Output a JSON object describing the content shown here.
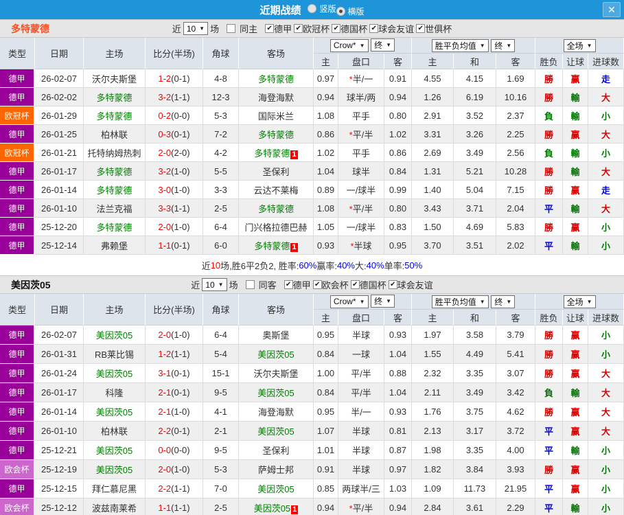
{
  "titlebar": {
    "title": "近期战绩",
    "bar_color": "#1e95d8",
    "radios": [
      {
        "label": "竖版",
        "checked": false
      },
      {
        "label": "横版",
        "checked": true
      }
    ],
    "close_label": "✕"
  },
  "table_head": {
    "static_cols": [
      "类型",
      "日期",
      "主场",
      "比分(半场)",
      "角球",
      "客场"
    ],
    "odds_company_dropdown": "Crow*",
    "odds_final_dropdown": "终",
    "mean_dropdown": "胜平负均值",
    "mean_final_dropdown": "终",
    "scope_dropdown": "全场",
    "sub_cols": [
      "主",
      "盘口",
      "客",
      "主",
      "和",
      "客",
      "胜负",
      "让球",
      "进球数"
    ]
  },
  "league_colors": {
    "德甲": "#990099",
    "欧冠杯": "#ff6600",
    "欧会杯": "#cc66cc"
  },
  "result_colors": {
    "勝": "#dd0000",
    "赢": "#dd0000",
    "大": "#dd0000",
    "負": "#007700",
    "輸": "#007700",
    "小": "#007700",
    "平": "#0000dd",
    "走": "#0000dd"
  },
  "sections": [
    {
      "team": "多特蒙德",
      "team_color": "#ff4f1f",
      "focus": "多特蒙德",
      "filter": {
        "prefix": "近",
        "count": "10",
        "suffix": "场",
        "checkboxes": [
          {
            "label": "同主",
            "checked": false
          },
          {
            "label": "德甲",
            "checked": true
          },
          {
            "label": "欧冠杯",
            "checked": true
          },
          {
            "label": "德国杯",
            "checked": true
          },
          {
            "label": "球会友谊",
            "checked": true
          },
          {
            "label": "世俱杯",
            "checked": true
          }
        ]
      },
      "rows": [
        {
          "league": "德甲",
          "date": "26-02-07",
          "home": "沃尔夫斯堡",
          "home_mark": "",
          "score": "1-2",
          "half": "(0-1)",
          "corner": "4-8",
          "away": "多特蒙德",
          "away_mark": "",
          "odds": [
            "0.97",
            "*半/一",
            "0.91"
          ],
          "means": [
            "4.55",
            "4.15",
            "1.69"
          ],
          "results": [
            "勝",
            "赢",
            "走"
          ]
        },
        {
          "league": "德甲",
          "date": "26-02-02",
          "home": "多特蒙德",
          "home_mark": "",
          "score": "3-2",
          "half": "(1-1)",
          "corner": "12-3",
          "away": "海登海默",
          "away_mark": "",
          "odds": [
            "0.94",
            "球半/两",
            "0.94"
          ],
          "means": [
            "1.26",
            "6.19",
            "10.16"
          ],
          "results": [
            "勝",
            "輸",
            "大"
          ]
        },
        {
          "league": "欧冠杯",
          "date": "26-01-29",
          "home": "多特蒙德",
          "home_mark": "",
          "score": "0-2",
          "half": "(0-0)",
          "corner": "5-3",
          "away": "国际米兰",
          "away_mark": "",
          "odds": [
            "1.08",
            "平手",
            "0.80"
          ],
          "means": [
            "2.91",
            "3.52",
            "2.37"
          ],
          "results": [
            "負",
            "輸",
            "小"
          ]
        },
        {
          "league": "德甲",
          "date": "26-01-25",
          "home": "柏林联",
          "home_mark": "",
          "score": "0-3",
          "half": "(0-1)",
          "corner": "7-2",
          "away": "多特蒙德",
          "away_mark": "",
          "odds": [
            "0.86",
            "*平/半",
            "1.02"
          ],
          "means": [
            "3.31",
            "3.26",
            "2.25"
          ],
          "results": [
            "勝",
            "赢",
            "大"
          ]
        },
        {
          "league": "欧冠杯",
          "date": "26-01-21",
          "home": "托特纳姆热刺",
          "home_mark": "",
          "score": "2-0",
          "half": "(2-0)",
          "corner": "4-2",
          "away": "多特蒙德",
          "away_mark": "1",
          "odds": [
            "1.02",
            "平手",
            "0.86"
          ],
          "means": [
            "2.69",
            "3.49",
            "2.56"
          ],
          "results": [
            "負",
            "輸",
            "小"
          ]
        },
        {
          "league": "德甲",
          "date": "26-01-17",
          "home": "多特蒙德",
          "home_mark": "",
          "score": "3-2",
          "half": "(1-0)",
          "corner": "5-5",
          "away": "圣保利",
          "away_mark": "",
          "odds": [
            "1.04",
            "球半",
            "0.84"
          ],
          "means": [
            "1.31",
            "5.21",
            "10.28"
          ],
          "results": [
            "勝",
            "輸",
            "大"
          ]
        },
        {
          "league": "德甲",
          "date": "26-01-14",
          "home": "多特蒙德",
          "home_mark": "",
          "score": "3-0",
          "half": "(1-0)",
          "corner": "3-3",
          "away": "云达不莱梅",
          "away_mark": "",
          "odds": [
            "0.89",
            "一/球半",
            "0.99"
          ],
          "means": [
            "1.40",
            "5.04",
            "7.15"
          ],
          "results": [
            "勝",
            "赢",
            "走"
          ]
        },
        {
          "league": "德甲",
          "date": "26-01-10",
          "home": "法兰克福",
          "home_mark": "",
          "score": "3-3",
          "half": "(1-1)",
          "corner": "2-5",
          "away": "多特蒙德",
          "away_mark": "",
          "odds": [
            "1.08",
            "*平/半",
            "0.80"
          ],
          "means": [
            "3.43",
            "3.71",
            "2.04"
          ],
          "results": [
            "平",
            "輸",
            "大"
          ]
        },
        {
          "league": "德甲",
          "date": "25-12-20",
          "home": "多特蒙德",
          "home_mark": "",
          "score": "2-0",
          "half": "(1-0)",
          "corner": "6-4",
          "away": "门兴格拉德巴赫",
          "away_mark": "",
          "odds": [
            "1.05",
            "一/球半",
            "0.83"
          ],
          "means": [
            "1.50",
            "4.69",
            "5.83"
          ],
          "results": [
            "勝",
            "赢",
            "小"
          ]
        },
        {
          "league": "德甲",
          "date": "25-12-14",
          "home": "弗赖堡",
          "home_mark": "",
          "score": "1-1",
          "half": "(0-1)",
          "corner": "6-0",
          "away": "多特蒙德",
          "away_mark": "1",
          "odds": [
            "0.93",
            "*半球",
            "0.95"
          ],
          "means": [
            "3.70",
            "3.51",
            "2.02"
          ],
          "results": [
            "平",
            "輸",
            "小"
          ]
        }
      ],
      "summary": [
        [
          "近",
          "#333333"
        ],
        [
          "10",
          "#ff0000"
        ],
        [
          "场,胜6平2负2, 胜率:",
          "#333333"
        ],
        [
          "60%",
          "#0000ee"
        ],
        [
          " 赢率:",
          "#333333"
        ],
        [
          "40%",
          "#0000ee"
        ],
        [
          " 大:",
          "#333333"
        ],
        [
          "40%",
          "#0000ee"
        ],
        [
          " 单率:",
          "#333333"
        ],
        [
          "50%",
          "#0000ee"
        ]
      ]
    },
    {
      "team": "美因茨05",
      "team_color": "#111111",
      "focus": "美因茨05",
      "filter": {
        "prefix": "近",
        "count": "10",
        "suffix": "场",
        "checkboxes": [
          {
            "label": "同客",
            "checked": false
          },
          {
            "label": "德甲",
            "checked": true
          },
          {
            "label": "欧会杯",
            "checked": true
          },
          {
            "label": "德国杯",
            "checked": true
          },
          {
            "label": "球会友谊",
            "checked": true
          }
        ]
      },
      "rows": [
        {
          "league": "德甲",
          "date": "26-02-07",
          "home": "美因茨05",
          "home_mark": "",
          "score": "2-0",
          "half": "(1-0)",
          "corner": "6-4",
          "away": "奥斯堡",
          "away_mark": "",
          "odds": [
            "0.95",
            "半球",
            "0.93"
          ],
          "means": [
            "1.97",
            "3.58",
            "3.79"
          ],
          "results": [
            "勝",
            "赢",
            "小"
          ]
        },
        {
          "league": "德甲",
          "date": "26-01-31",
          "home": "RB莱比锡",
          "home_mark": "",
          "score": "1-2",
          "half": "(1-1)",
          "corner": "5-4",
          "away": "美因茨05",
          "away_mark": "",
          "odds": [
            "0.84",
            "一球",
            "1.04"
          ],
          "means": [
            "1.55",
            "4.49",
            "5.41"
          ],
          "results": [
            "勝",
            "赢",
            "小"
          ]
        },
        {
          "league": "德甲",
          "date": "26-01-24",
          "home": "美因茨05",
          "home_mark": "",
          "score": "3-1",
          "half": "(0-1)",
          "corner": "15-1",
          "away": "沃尔夫斯堡",
          "away_mark": "",
          "odds": [
            "1.00",
            "平/半",
            "0.88"
          ],
          "means": [
            "2.32",
            "3.35",
            "3.07"
          ],
          "results": [
            "勝",
            "赢",
            "大"
          ]
        },
        {
          "league": "德甲",
          "date": "26-01-17",
          "home": "科隆",
          "home_mark": "",
          "score": "2-1",
          "half": "(0-1)",
          "corner": "9-5",
          "away": "美因茨05",
          "away_mark": "",
          "odds": [
            "0.84",
            "平/半",
            "1.04"
          ],
          "means": [
            "2.11",
            "3.49",
            "3.42"
          ],
          "results": [
            "負",
            "輸",
            "大"
          ]
        },
        {
          "league": "德甲",
          "date": "26-01-14",
          "home": "美因茨05",
          "home_mark": "",
          "score": "2-1",
          "half": "(1-0)",
          "corner": "4-1",
          "away": "海登海默",
          "away_mark": "",
          "odds": [
            "0.95",
            "半/一",
            "0.93"
          ],
          "means": [
            "1.76",
            "3.75",
            "4.62"
          ],
          "results": [
            "勝",
            "赢",
            "大"
          ]
        },
        {
          "league": "德甲",
          "date": "26-01-10",
          "home": "柏林联",
          "home_mark": "",
          "score": "2-2",
          "half": "(0-1)",
          "corner": "2-1",
          "away": "美因茨05",
          "away_mark": "",
          "odds": [
            "1.07",
            "半球",
            "0.81"
          ],
          "means": [
            "2.13",
            "3.17",
            "3.72"
          ],
          "results": [
            "平",
            "赢",
            "大"
          ]
        },
        {
          "league": "德甲",
          "date": "25-12-21",
          "home": "美因茨05",
          "home_mark": "",
          "score": "0-0",
          "half": "(0-0)",
          "corner": "9-5",
          "away": "圣保利",
          "away_mark": "",
          "odds": [
            "1.01",
            "半球",
            "0.87"
          ],
          "means": [
            "1.98",
            "3.35",
            "4.00"
          ],
          "results": [
            "平",
            "輸",
            "小"
          ]
        },
        {
          "league": "欧会杯",
          "date": "25-12-19",
          "home": "美因茨05",
          "home_mark": "",
          "score": "2-0",
          "half": "(1-0)",
          "corner": "5-3",
          "away": "萨姆士邦",
          "away_mark": "",
          "odds": [
            "0.91",
            "半球",
            "0.97"
          ],
          "means": [
            "1.82",
            "3.84",
            "3.93"
          ],
          "results": [
            "勝",
            "赢",
            "小"
          ]
        },
        {
          "league": "德甲",
          "date": "25-12-15",
          "home": "拜仁慕尼黑",
          "home_mark": "",
          "score": "2-2",
          "half": "(1-1)",
          "corner": "7-0",
          "away": "美因茨05",
          "away_mark": "",
          "odds": [
            "0.85",
            "两球半/三",
            "1.03"
          ],
          "means": [
            "1.09",
            "11.73",
            "21.95"
          ],
          "results": [
            "平",
            "赢",
            "小"
          ]
        },
        {
          "league": "欧会杯",
          "date": "25-12-12",
          "home": "波兹南莱希",
          "home_mark": "",
          "score": "1-1",
          "half": "(1-1)",
          "corner": "2-5",
          "away": "美因茨05",
          "away_mark": "1",
          "odds": [
            "0.94",
            "*平/半",
            "0.94"
          ],
          "means": [
            "2.84",
            "3.61",
            "2.29"
          ],
          "results": [
            "平",
            "輸",
            "小"
          ]
        }
      ]
    }
  ]
}
